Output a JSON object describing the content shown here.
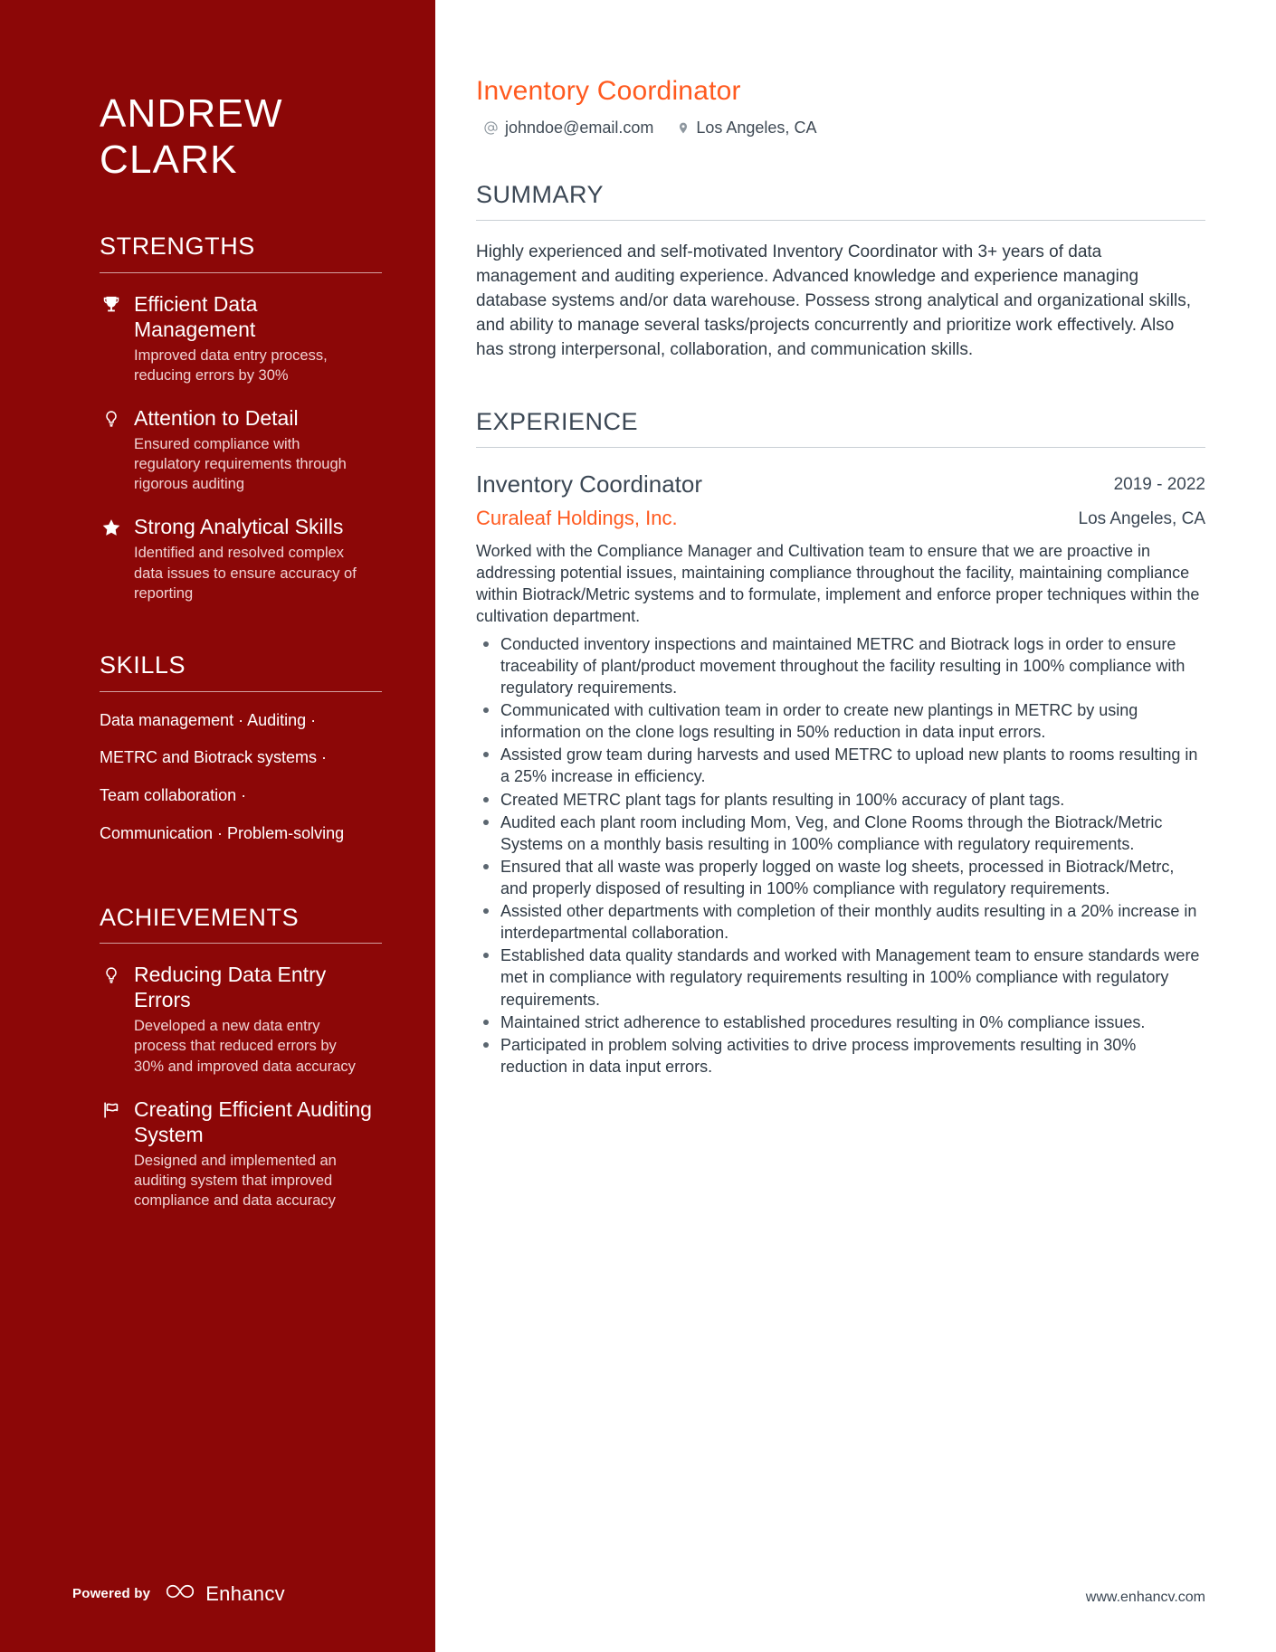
{
  "sidebar": {
    "name_line1": "ANDREW",
    "name_line2": "CLARK",
    "strengths": {
      "title": "STRENGTHS",
      "items": [
        {
          "icon": "trophy-icon",
          "name": "Efficient Data Management",
          "desc": "Improved data entry process, reducing errors by 30%"
        },
        {
          "icon": "lightbulb-icon",
          "name": "Attention to Detail",
          "desc": "Ensured compliance with regulatory requirements through rigorous auditing"
        },
        {
          "icon": "star-icon",
          "name": "Strong Analytical Skills",
          "desc": "Identified and resolved complex data issues to ensure accuracy of reporting"
        }
      ]
    },
    "skills": {
      "title": "SKILLS",
      "lines": [
        "Data management · Auditing ·",
        "METRC and Biotrack systems ·",
        "Team collaboration ·",
        "Communication · Problem-solving"
      ]
    },
    "achievements": {
      "title": "ACHIEVEMENTS",
      "items": [
        {
          "icon": "lightbulb-icon",
          "name": "Reducing Data Entry Errors",
          "desc": "Developed a new data entry process that reduced errors by 30% and improved data accuracy"
        },
        {
          "icon": "flag-icon",
          "name": "Creating Efficient Auditing System",
          "desc": "Designed and implemented an auditing system that improved compliance and data accuracy"
        }
      ]
    },
    "footer": {
      "powered_by": "Powered by",
      "brand": "Enhancv",
      "logo_icon": "infinity-logo-icon"
    }
  },
  "main": {
    "job_title": "Inventory Coordinator",
    "contact": {
      "email": "johndoe@email.com",
      "email_icon": "at-icon",
      "location": "Los Angeles, CA",
      "location_icon": "map-pin-icon"
    },
    "summary": {
      "title": "SUMMARY",
      "text": "Highly experienced and self-motivated Inventory Coordinator with 3+ years of data management and auditing experience. Advanced knowledge and experience managing database systems and/or data warehouse. Possess strong analytical and organizational skills, and ability to manage several tasks/projects concurrently and prioritize work effectively. Also has strong interpersonal, collaboration, and communication skills."
    },
    "experience": {
      "title": "EXPERIENCE",
      "entries": [
        {
          "role": "Inventory Coordinator",
          "company": "Curaleaf Holdings, Inc.",
          "dates": "2019 - 2022",
          "location": "Los Angeles, CA",
          "description": "Worked with the Compliance Manager and Cultivation team to ensure that we are proactive in addressing potential issues, maintaining compliance throughout the facility, maintaining compliance within Biotrack/Metric systems and to formulate, implement and enforce proper techniques within the cultivation department.",
          "bullets": [
            "Conducted inventory inspections and maintained METRC and Biotrack logs in order to ensure traceability of plant/product movement throughout the facility resulting in 100% compliance with regulatory requirements.",
            "Communicated with cultivation team in order to create new plantings in METRC by using information on the clone logs resulting in 50% reduction in data input errors.",
            "Assisted grow team during harvests and used METRC to upload new plants to rooms resulting in a 25% increase in efficiency.",
            "Created METRC plant tags for plants resulting in 100% accuracy of plant tags.",
            "Audited each plant room including Mom, Veg, and Clone Rooms through the Biotrack/Metric Systems on a monthly basis resulting in 100% compliance with regulatory requirements.",
            "Ensured that all waste was properly logged on waste log sheets, processed in Biotrack/Metrc, and properly disposed of resulting in 100% compliance with regulatory requirements.",
            "Assisted other departments with completion of their monthly audits resulting in a 20% increase in interdepartmental collaboration.",
            "Established data quality standards and worked with Management team to ensure standards were met in compliance with regulatory requirements resulting in 100% compliance with regulatory requirements.",
            "Maintained strict adherence to established procedures resulting in 0% compliance issues.",
            "Participated in problem solving activities to drive process improvements resulting in 30% reduction in data input errors."
          ]
        }
      ]
    },
    "footer_url": "www.enhancv.com"
  },
  "colors": {
    "sidebar_bg": "#8c0707",
    "accent_orange": "#ff5a1f",
    "heading_gray": "#3b4754"
  }
}
